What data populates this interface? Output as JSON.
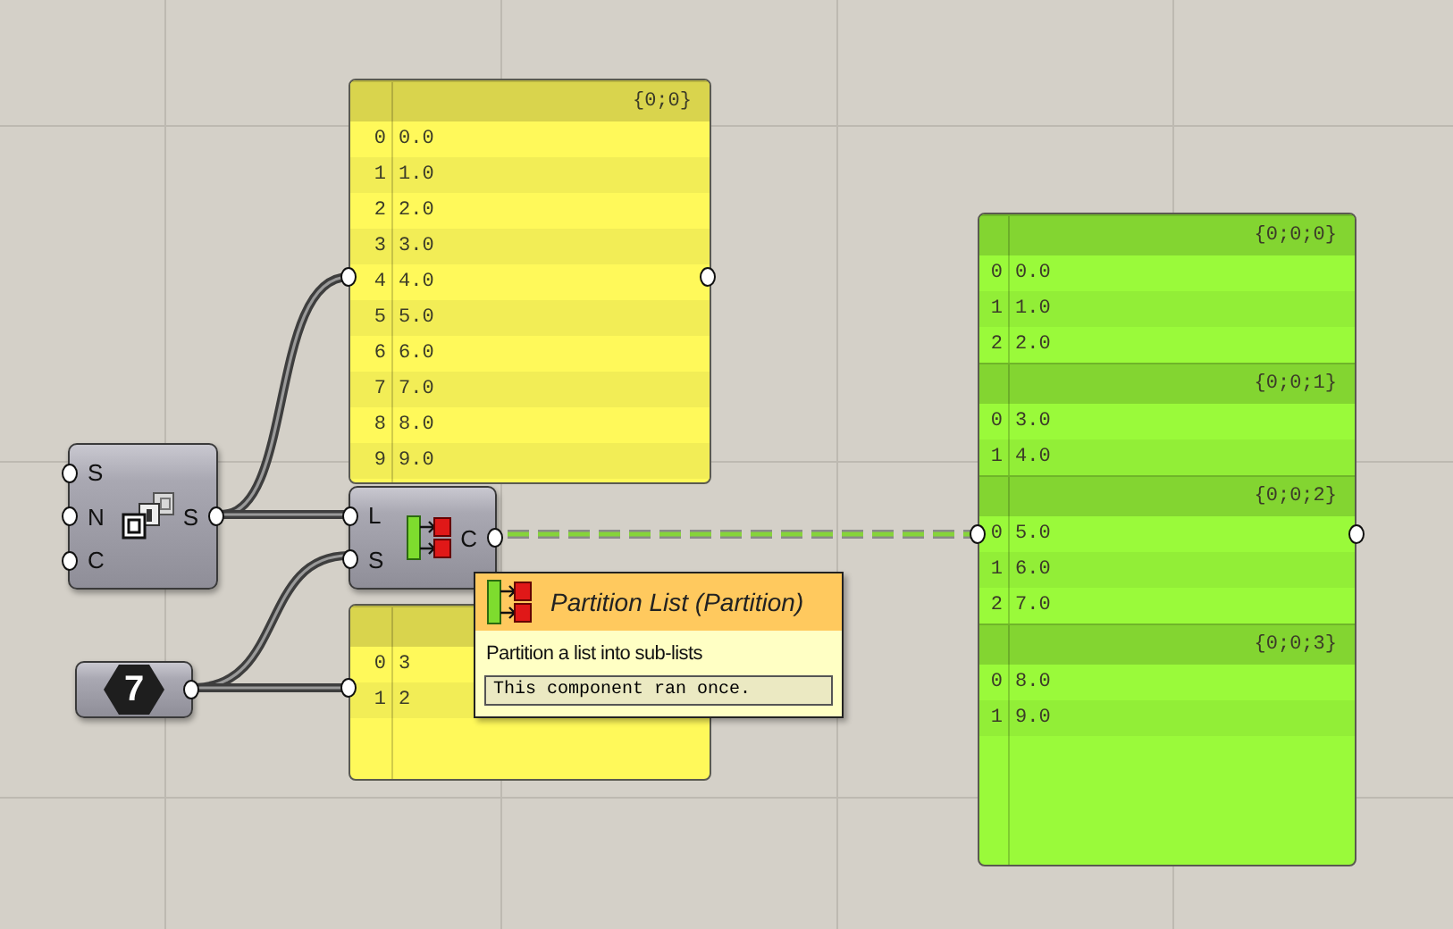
{
  "components": [
    {
      "kind": "series",
      "inputs": [
        "S",
        "N",
        "C"
      ],
      "outputs": [
        "S"
      ]
    },
    {
      "kind": "partition",
      "inputs": [
        "L",
        "S"
      ],
      "outputs": [
        "C"
      ]
    },
    {
      "kind": "number",
      "value": "7"
    }
  ],
  "panels": [
    {
      "color": "#fff95a",
      "branches": [
        {
          "path": "{0;0}",
          "items": [
            {
              "index": "0",
              "value": "0.0"
            },
            {
              "index": "1",
              "value": "1.0"
            },
            {
              "index": "2",
              "value": "2.0"
            },
            {
              "index": "3",
              "value": "3.0"
            },
            {
              "index": "4",
              "value": "4.0"
            },
            {
              "index": "5",
              "value": "5.0"
            },
            {
              "index": "6",
              "value": "6.0"
            },
            {
              "index": "7",
              "value": "7.0"
            },
            {
              "index": "8",
              "value": "8.0"
            },
            {
              "index": "9",
              "value": "9.0"
            }
          ]
        }
      ]
    },
    {
      "color": "#fff95a",
      "branches": [
        {
          "items": [
            {
              "index": "0",
              "value": "3"
            },
            {
              "index": "1",
              "value": "2"
            }
          ]
        }
      ]
    },
    {
      "color": "#9afa3a",
      "branches": [
        {
          "path": "{0;0;0}",
          "items": [
            {
              "index": "0",
              "value": "0.0"
            },
            {
              "index": "1",
              "value": "1.0"
            },
            {
              "index": "2",
              "value": "2.0"
            }
          ]
        },
        {
          "path": "{0;0;1}",
          "items": [
            {
              "index": "0",
              "value": "3.0"
            },
            {
              "index": "1",
              "value": "4.0"
            }
          ]
        },
        {
          "path": "{0;0;2}",
          "items": [
            {
              "index": "0",
              "value": "5.0"
            },
            {
              "index": "1",
              "value": "6.0"
            },
            {
              "index": "2",
              "value": "7.0"
            }
          ]
        },
        {
          "path": "{0;0;3}",
          "items": [
            {
              "index": "0",
              "value": "8.0"
            },
            {
              "index": "1",
              "value": "9.0"
            }
          ]
        }
      ]
    }
  ],
  "tooltip": {
    "title": "Partition List (Partition)",
    "description": "Partition a list into sub-lists",
    "status": "This component ran once."
  }
}
